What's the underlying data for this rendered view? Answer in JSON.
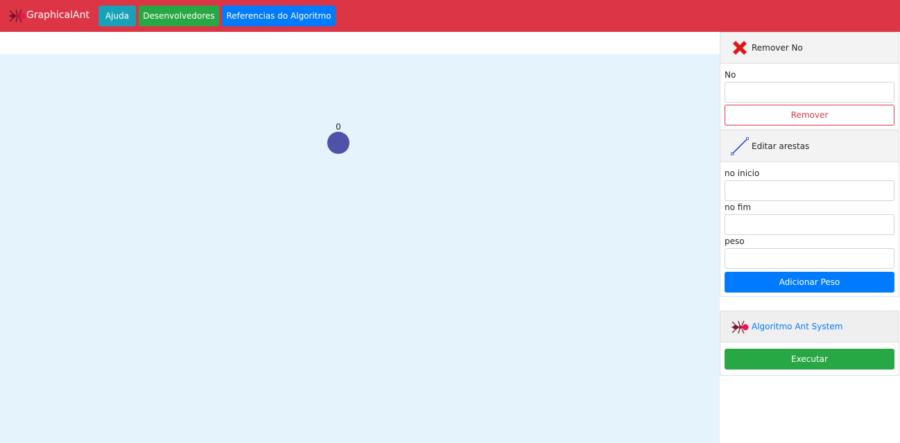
{
  "navbar": {
    "brand": "GraphicalAnt",
    "brand_icon": "ant-icon",
    "buttons": {
      "help": "Ajuda",
      "developers": "Desenvolvedores",
      "references": "Referencias do Algoritmo"
    }
  },
  "graph": {
    "nodes": [
      {
        "label": "0"
      }
    ]
  },
  "remove_node": {
    "title": "Remover No",
    "icon": "red-x-icon",
    "field_label": "No",
    "field_value": "",
    "button": "Remover"
  },
  "edit_edges": {
    "title": "Editar arestas",
    "icon": "line-icon",
    "start_label": "no inicio",
    "end_label": "no fim",
    "weight_label": "peso",
    "start_value": "",
    "end_value": "",
    "weight_value": "",
    "button": "Adicionar Peso"
  },
  "ant_system": {
    "title": "Algoritmo Ant System",
    "icon": "ant-icon",
    "button": "Executar"
  },
  "colors": {
    "navbar": "#dc3545",
    "help": "#17a2b8",
    "developers": "#28a745",
    "references": "#007bff",
    "canvas": "#e5f3fd",
    "node": "#5151a8"
  }
}
